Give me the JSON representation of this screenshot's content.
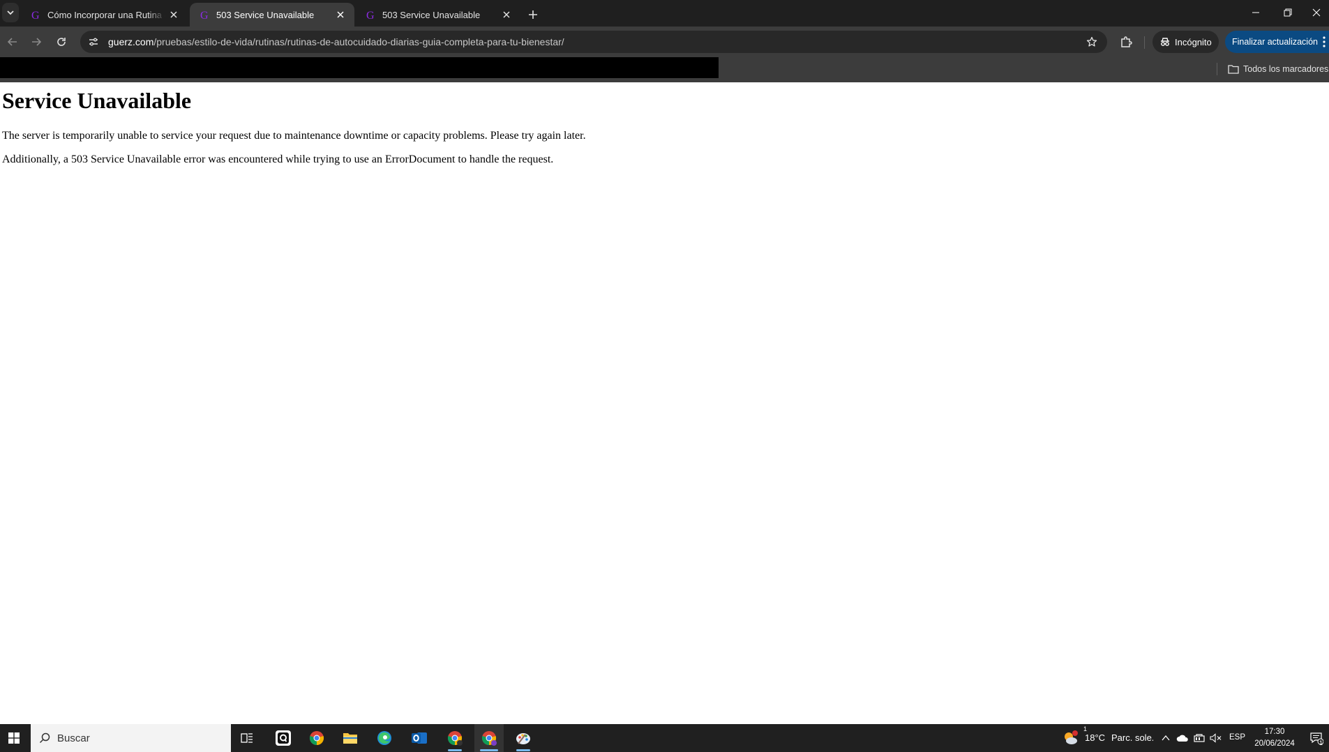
{
  "tabs": [
    {
      "title": "Cómo Incorporar una Rutina de Autocuidado",
      "active": false
    },
    {
      "title": "503 Service Unavailable",
      "active": true
    },
    {
      "title": "503 Service Unavailable",
      "active": false
    }
  ],
  "toolbar": {
    "url_host": "guerz.com",
    "url_path": "/pruebas/estilo-de-vida/rutinas/rutinas-de-autocuidado-diarias-guia-completa-para-tu-bienestar/",
    "incognito_label": "Incógnito",
    "update_label": "Finalizar actualización"
  },
  "bookmarks": {
    "all_bookmarks_label": "Todos los marcadores"
  },
  "page": {
    "heading": "Service Unavailable",
    "paragraph1": "The server is temporarily unable to service your request due to maintenance downtime or capacity problems. Please try again later.",
    "paragraph2": "Additionally, a 503 Service Unavailable error was encountered while trying to use an ErrorDocument to handle the request."
  },
  "taskbar": {
    "search_placeholder": "Buscar",
    "weather_temp": "18°C",
    "weather_desc": "Parc. sole.",
    "weather_badge": "1",
    "language": "ESP",
    "time": "17:30",
    "date": "20/06/2024",
    "notification_count": "1",
    "apps": [
      "task-view",
      "app-q",
      "chrome",
      "file-explorer",
      "edge",
      "outlook",
      "chrome-profile-1",
      "chrome-profile-2",
      "paint"
    ]
  },
  "colors": {
    "tabstrip_bg": "#1f1f1f",
    "toolbar_bg": "#3c3c3c",
    "update_button": "#0b4a82",
    "favicon_purple": "#8a2be2"
  }
}
